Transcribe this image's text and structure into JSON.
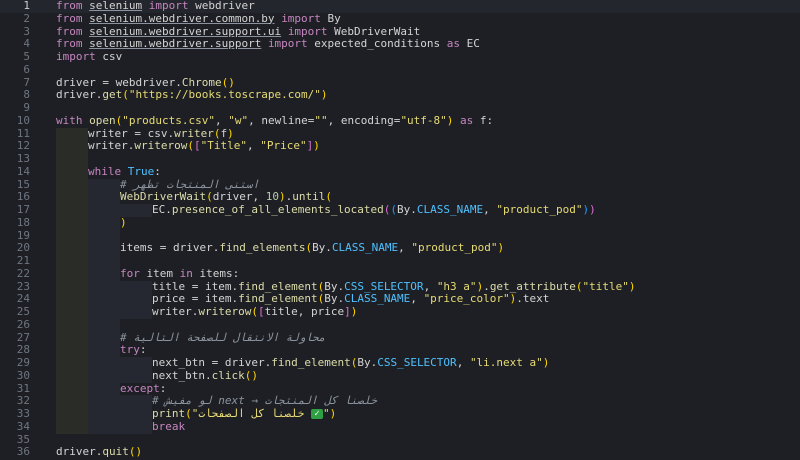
{
  "editor": {
    "lines": [
      {
        "n": "1",
        "indent": 0,
        "tokens": [
          [
            "kw",
            "from"
          ],
          [
            "",
            " "
          ],
          [
            "u",
            "selenium"
          ],
          [
            "",
            " "
          ],
          [
            "kw",
            "import"
          ],
          [
            "",
            " webdriver"
          ]
        ]
      },
      {
        "n": "2",
        "indent": 0,
        "tokens": [
          [
            "kw",
            "from"
          ],
          [
            "",
            " "
          ],
          [
            "u",
            "selenium.webdriver.common.by"
          ],
          [
            "",
            " "
          ],
          [
            "kw",
            "import"
          ],
          [
            "",
            " By"
          ]
        ]
      },
      {
        "n": "3",
        "indent": 0,
        "tokens": [
          [
            "kw",
            "from"
          ],
          [
            "",
            " "
          ],
          [
            "u",
            "selenium.webdriver.support.ui"
          ],
          [
            "",
            " "
          ],
          [
            "kw",
            "import"
          ],
          [
            "",
            " WebDriverWait"
          ]
        ]
      },
      {
        "n": "4",
        "indent": 0,
        "tokens": [
          [
            "kw",
            "from"
          ],
          [
            "",
            " "
          ],
          [
            "u",
            "selenium.webdriver.support"
          ],
          [
            "",
            " "
          ],
          [
            "kw",
            "import"
          ],
          [
            "",
            " expected_conditions "
          ],
          [
            "kw",
            "as"
          ],
          [
            "",
            " EC"
          ]
        ]
      },
      {
        "n": "5",
        "indent": 0,
        "tokens": [
          [
            "kw",
            "import"
          ],
          [
            "",
            " csv"
          ]
        ]
      },
      {
        "n": "6",
        "indent": 0,
        "tokens": []
      },
      {
        "n": "7",
        "indent": 0,
        "tokens": [
          [
            "",
            "driver = webdriver."
          ],
          [
            "fn",
            "Chrome"
          ],
          [
            "br1",
            "()"
          ]
        ]
      },
      {
        "n": "8",
        "indent": 0,
        "tokens": [
          [
            "",
            "driver."
          ],
          [
            "fn",
            "get"
          ],
          [
            "br1",
            "("
          ],
          [
            "str",
            "\"https://books.toscrape.com/\""
          ],
          [
            "br1",
            ")"
          ]
        ]
      },
      {
        "n": "9",
        "indent": 0,
        "tokens": []
      },
      {
        "n": "10",
        "indent": 0,
        "tokens": [
          [
            "kw",
            "with"
          ],
          [
            "",
            " "
          ],
          [
            "fn",
            "open"
          ],
          [
            "br1",
            "("
          ],
          [
            "str",
            "\"products.csv\""
          ],
          [
            "",
            ", "
          ],
          [
            "str",
            "\"w\""
          ],
          [
            "",
            ", newline="
          ],
          [
            "str",
            "\"\""
          ],
          [
            "",
            ", encoding="
          ],
          [
            "str",
            "\"utf-8\""
          ],
          [
            "br1",
            ")"
          ],
          [
            "",
            " "
          ],
          [
            "kw",
            "as"
          ],
          [
            "",
            " f:"
          ]
        ]
      },
      {
        "n": "11",
        "indent": 1,
        "tokens": [
          [
            "",
            "writer = csv."
          ],
          [
            "fn",
            "writer"
          ],
          [
            "br1",
            "("
          ],
          [
            "",
            "f"
          ],
          [
            "br1",
            ")"
          ]
        ]
      },
      {
        "n": "12",
        "indent": 1,
        "tokens": [
          [
            "",
            "writer."
          ],
          [
            "fn",
            "writerow"
          ],
          [
            "br1",
            "("
          ],
          [
            "br2",
            "["
          ],
          [
            "str",
            "\"Title\""
          ],
          [
            "",
            ", "
          ],
          [
            "str",
            "\"Price\""
          ],
          [
            "br2",
            "]"
          ],
          [
            "br1",
            ")"
          ]
        ]
      },
      {
        "n": "13",
        "indent": 1,
        "tokens": []
      },
      {
        "n": "14",
        "indent": 1,
        "tokens": [
          [
            "kw",
            "while"
          ],
          [
            "",
            " "
          ],
          [
            "const",
            "True"
          ],
          [
            "",
            ":"
          ]
        ]
      },
      {
        "n": "15",
        "indent": 2,
        "tokens": [
          [
            "cm",
            "# استنى المنتجات تظهر"
          ]
        ]
      },
      {
        "n": "16",
        "indent": 2,
        "tokens": [
          [
            "fn",
            "WebDriverWait"
          ],
          [
            "br1",
            "("
          ],
          [
            "",
            "driver, "
          ],
          [
            "num",
            "10"
          ],
          [
            "br1",
            ")"
          ],
          [
            "",
            "."
          ],
          [
            "fn",
            "until"
          ],
          [
            "br1",
            "("
          ]
        ]
      },
      {
        "n": "17",
        "indent": 3,
        "tokens": [
          [
            "",
            "EC."
          ],
          [
            "fn",
            "presence_of_all_elements_located"
          ],
          [
            "br2",
            "("
          ],
          [
            "br3",
            "("
          ],
          [
            "",
            "By."
          ],
          [
            "const",
            "CLASS_NAME"
          ],
          [
            "",
            ", "
          ],
          [
            "str",
            "\"product_pod\""
          ],
          [
            "br3",
            ")"
          ],
          [
            "br2",
            ")"
          ]
        ]
      },
      {
        "n": "18",
        "indent": 2,
        "tokens": [
          [
            "br1",
            ")"
          ]
        ]
      },
      {
        "n": "19",
        "indent": 2,
        "tokens": []
      },
      {
        "n": "20",
        "indent": 2,
        "tokens": [
          [
            "",
            "items = driver."
          ],
          [
            "fn",
            "find_elements"
          ],
          [
            "br1",
            "("
          ],
          [
            "",
            "By."
          ],
          [
            "const",
            "CLASS_NAME"
          ],
          [
            "",
            ", "
          ],
          [
            "str",
            "\"product_pod\""
          ],
          [
            "br1",
            ")"
          ]
        ]
      },
      {
        "n": "21",
        "indent": 2,
        "tokens": []
      },
      {
        "n": "22",
        "indent": 2,
        "tokens": [
          [
            "kw",
            "for"
          ],
          [
            "",
            " item "
          ],
          [
            "kw",
            "in"
          ],
          [
            "",
            " items:"
          ]
        ]
      },
      {
        "n": "23",
        "indent": 3,
        "tokens": [
          [
            "",
            "title = item."
          ],
          [
            "fn",
            "find_element"
          ],
          [
            "br1",
            "("
          ],
          [
            "",
            "By."
          ],
          [
            "const",
            "CSS_SELECTOR"
          ],
          [
            "",
            ", "
          ],
          [
            "str",
            "\"h3 a\""
          ],
          [
            "br1",
            ")"
          ],
          [
            "",
            "."
          ],
          [
            "fn",
            "get_attribute"
          ],
          [
            "br1",
            "("
          ],
          [
            "str",
            "\"title\""
          ],
          [
            "br1",
            ")"
          ]
        ]
      },
      {
        "n": "24",
        "indent": 3,
        "tokens": [
          [
            "",
            "price = item."
          ],
          [
            "fn",
            "find_element"
          ],
          [
            "br1",
            "("
          ],
          [
            "",
            "By."
          ],
          [
            "const",
            "CLASS_NAME"
          ],
          [
            "",
            ", "
          ],
          [
            "str",
            "\"price_color\""
          ],
          [
            "br1",
            ")"
          ],
          [
            "",
            ".text"
          ]
        ]
      },
      {
        "n": "25",
        "indent": 3,
        "tokens": [
          [
            "",
            "writer."
          ],
          [
            "fn",
            "writerow"
          ],
          [
            "br1",
            "("
          ],
          [
            "br2",
            "["
          ],
          [
            "",
            "title, price"
          ],
          [
            "br2",
            "]"
          ],
          [
            "br1",
            ")"
          ]
        ]
      },
      {
        "n": "26",
        "indent": 2,
        "tokens": []
      },
      {
        "n": "27",
        "indent": 2,
        "tokens": [
          [
            "cm",
            "# محاولة الانتقال للصفحة التالية"
          ]
        ]
      },
      {
        "n": "28",
        "indent": 2,
        "tokens": [
          [
            "kw",
            "try"
          ],
          [
            "",
            ":"
          ]
        ]
      },
      {
        "n": "29",
        "indent": 3,
        "tokens": [
          [
            "",
            "next_btn = driver."
          ],
          [
            "fn",
            "find_element"
          ],
          [
            "br1",
            "("
          ],
          [
            "",
            "By."
          ],
          [
            "const",
            "CSS_SELECTOR"
          ],
          [
            "",
            ", "
          ],
          [
            "str",
            "\"li.next a\""
          ],
          [
            "br1",
            ")"
          ]
        ]
      },
      {
        "n": "30",
        "indent": 3,
        "tokens": [
          [
            "",
            "next_btn."
          ],
          [
            "fn",
            "click"
          ],
          [
            "br1",
            "()"
          ]
        ]
      },
      {
        "n": "31",
        "indent": 2,
        "tokens": [
          [
            "kw",
            "except"
          ],
          [
            "",
            ":"
          ]
        ]
      },
      {
        "n": "32",
        "indent": 3,
        "tokens": [
          [
            "cm",
            "# لو مفيش next → خلصنا كل المنتجات"
          ]
        ]
      },
      {
        "n": "33",
        "indent": 3,
        "tokens": [
          [
            "fn",
            "print"
          ],
          [
            "br1",
            "("
          ],
          [
            "str",
            "\"خلصنا كل الصفحات "
          ],
          [
            "emoji",
            "✓"
          ],
          [
            "str",
            "\""
          ],
          [
            "br1",
            ")"
          ]
        ]
      },
      {
        "n": "34",
        "indent": 3,
        "tokens": [
          [
            "kw",
            "break"
          ]
        ]
      },
      {
        "n": "35",
        "indent": 0,
        "tokens": []
      },
      {
        "n": "36",
        "indent": 0,
        "tokens": [
          [
            "",
            "driver."
          ],
          [
            "fn",
            "quit"
          ],
          [
            "br1",
            "()"
          ]
        ]
      }
    ],
    "current_line": "1"
  },
  "colors": {
    "background": "#1e1f24",
    "keyword": "#c586c0",
    "string": "#e6db74",
    "function": "#dcdcaa",
    "constant": "#4fc1ff"
  }
}
